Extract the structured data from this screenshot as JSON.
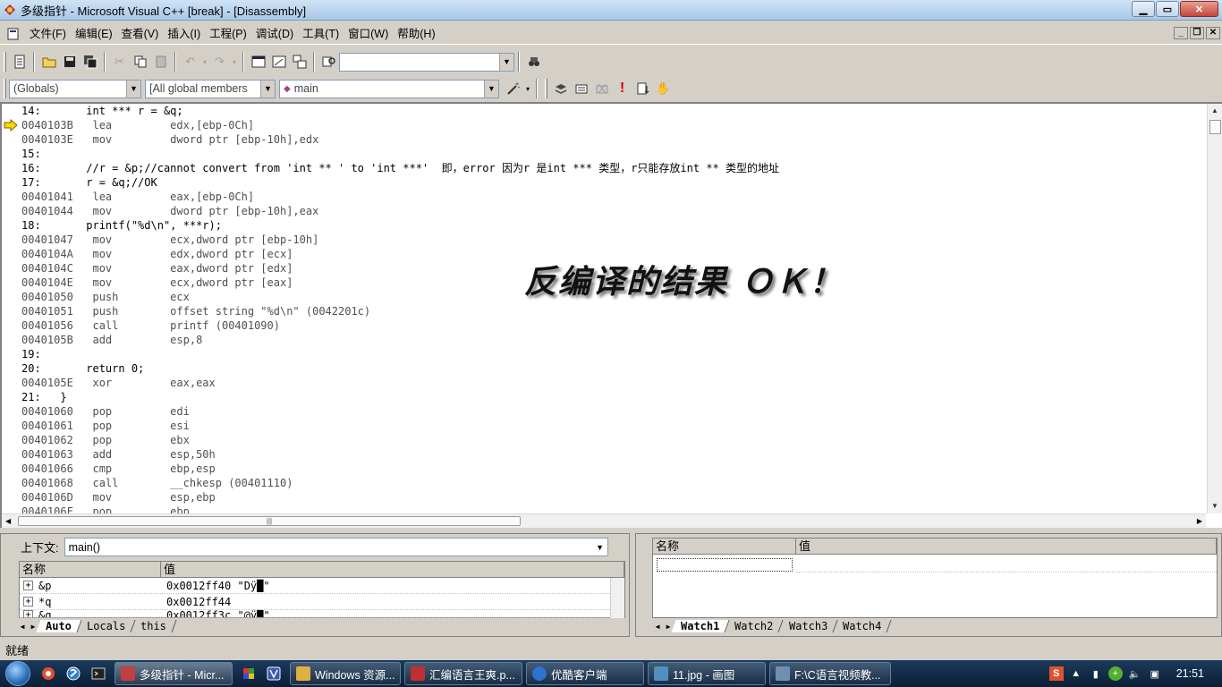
{
  "window": {
    "title": "多级指针 - Microsoft Visual C++ [break] - [Disassembly]"
  },
  "menu": {
    "items": [
      "文件(F)",
      "编辑(E)",
      "查看(V)",
      "插入(I)",
      "工程(P)",
      "调试(D)",
      "工具(T)",
      "窗口(W)",
      "帮助(H)"
    ]
  },
  "toolbar": {
    "find_combo_value": "",
    "globals_combo": "(Globals)",
    "members_combo": "[All global members",
    "function_combo": "main"
  },
  "editor": {
    "lines": [
      {
        "kind": "src",
        "text": "14:       int *** r = &q;"
      },
      {
        "kind": "asm",
        "text": "0040103B   lea         edx,[ebp-0Ch]"
      },
      {
        "kind": "asm",
        "text": "0040103E   mov         dword ptr [ebp-10h],edx"
      },
      {
        "kind": "src",
        "text": "15:"
      },
      {
        "kind": "src",
        "text": "16:       //r = &p;//cannot convert from 'int ** ' to 'int ***'  即，error 因为r 是int *** 类型，r只能存放int ** 类型的地址"
      },
      {
        "kind": "src",
        "text": "17:       r = &q;//OK"
      },
      {
        "kind": "asm",
        "text": "00401041   lea         eax,[ebp-0Ch]"
      },
      {
        "kind": "asm",
        "text": "00401044   mov         dword ptr [ebp-10h],eax"
      },
      {
        "kind": "src",
        "text": "18:       printf(\"%d\\n\", ***r);"
      },
      {
        "kind": "asm",
        "text": "00401047   mov         ecx,dword ptr [ebp-10h]"
      },
      {
        "kind": "asm",
        "text": "0040104A   mov         edx,dword ptr [ecx]"
      },
      {
        "kind": "asm",
        "text": "0040104C   mov         eax,dword ptr [edx]"
      },
      {
        "kind": "asm",
        "text": "0040104E   mov         ecx,dword ptr [eax]"
      },
      {
        "kind": "asm",
        "text": "00401050   push        ecx"
      },
      {
        "kind": "asm",
        "text": "00401051   push        offset string \"%d\\n\" (0042201c)"
      },
      {
        "kind": "asm",
        "text": "00401056   call        printf (00401090)"
      },
      {
        "kind": "asm",
        "text": "0040105B   add         esp,8"
      },
      {
        "kind": "src",
        "text": "19:"
      },
      {
        "kind": "src",
        "text": "20:       return 0;"
      },
      {
        "kind": "asm",
        "text": "0040105E   xor         eax,eax"
      },
      {
        "kind": "src",
        "text": "21:   }"
      },
      {
        "kind": "asm",
        "text": "00401060   pop         edi"
      },
      {
        "kind": "asm",
        "text": "00401061   pop         esi"
      },
      {
        "kind": "asm",
        "text": "00401062   pop         ebx"
      },
      {
        "kind": "asm",
        "text": "00401063   add         esp,50h"
      },
      {
        "kind": "asm",
        "text": "00401066   cmp         ebp,esp"
      },
      {
        "kind": "asm",
        "text": "00401068   call        __chkesp (00401110)"
      },
      {
        "kind": "asm",
        "text": "0040106D   mov         esp,ebp"
      },
      {
        "kind": "asm",
        "text": "0040106F   pop         ebp"
      }
    ],
    "overlay_text": "反编译的结果 ＯＫ！"
  },
  "variables": {
    "context_label": "上下文:",
    "context_value": "main()",
    "headers": [
      "名称",
      "值"
    ],
    "rows": [
      {
        "name": "&p",
        "value": "0x0012ff40 \"Dÿ█\""
      },
      {
        "name": "*q",
        "value": "0x0012ff44"
      },
      {
        "name": "&q",
        "value": "0x0012ff3c \"@ÿ█\""
      }
    ],
    "tabs": [
      "Auto",
      "Locals",
      "this"
    ]
  },
  "watch": {
    "headers": [
      "名称",
      "值"
    ],
    "tabs": [
      "Watch1",
      "Watch2",
      "Watch3",
      "Watch4"
    ]
  },
  "status": {
    "text": "就绪"
  },
  "taskbar": {
    "tasks": [
      {
        "label": "多级指针 - Micr...",
        "color": "#c04040"
      },
      {
        "label": "Windows 资源...",
        "color": "#e0b040"
      },
      {
        "label": "汇编语言王爽.p...",
        "color": "#c03030"
      },
      {
        "label": "优酷客户端",
        "color": "#3070d0"
      },
      {
        "label": "11.jpg - 画图",
        "color": "#5090c0"
      },
      {
        "label": "F:\\C语言视频教...",
        "color": "#7090b0"
      }
    ],
    "clock": "21:51"
  }
}
